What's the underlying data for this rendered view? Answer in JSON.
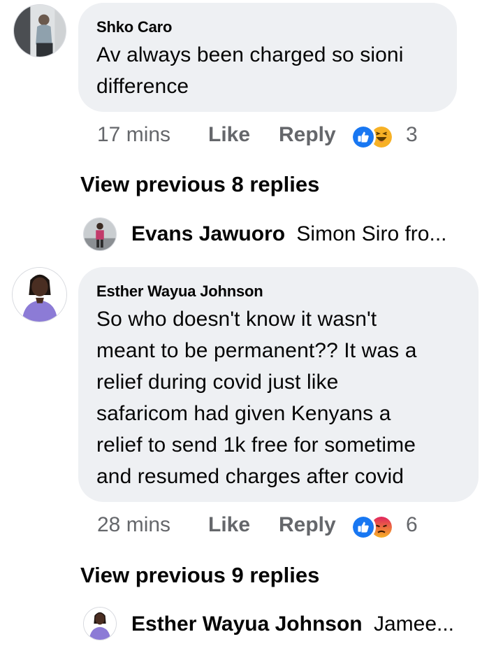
{
  "comments": [
    {
      "author": "Shko Caro",
      "text_lines": [
        "Av always been charged so sioni",
        "difference"
      ],
      "time": "17 mins",
      "like_label": "Like",
      "reply_label": "Reply",
      "reaction_count": "3",
      "reactions": [
        "like-icon",
        "haha-icon"
      ],
      "view_previous": "View previous 8 replies",
      "latest_reply": {
        "author": "Evans Jawuoro",
        "snippet": "Simon Siro fro..."
      }
    },
    {
      "author": "Esther Wayua Johnson",
      "text_lines": [
        "So who doesn't know it wasn't",
        "meant to be permanent?? It was a",
        "relief during covid just like",
        "safaricom had given Kenyans a",
        "relief to send 1k free for sometime",
        "and resumed charges after covid"
      ],
      "time": "28 mins",
      "like_label": "Like",
      "reply_label": "Reply",
      "reaction_count": "6",
      "reactions": [
        "like-icon",
        "angry-icon"
      ],
      "view_previous": "View previous 9 replies",
      "latest_reply": {
        "author": "Esther Wayua Johnson",
        "snippet": "Jamee..."
      }
    }
  ],
  "colors": {
    "bubble": "#eef0f3",
    "meta_text": "#65676b",
    "like_blue": "#1877f2",
    "haha_yellow": "#f7b125",
    "angry_orange": "#e9710f"
  }
}
